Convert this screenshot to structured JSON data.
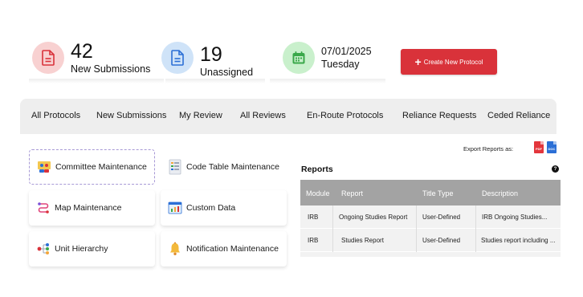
{
  "stats": [
    {
      "value": "42",
      "label": "New Submissions",
      "icon": "document-icon",
      "color": "#f8d1d1"
    },
    {
      "value": "19",
      "label": "Unassigned",
      "icon": "document-icon",
      "color": "#cfe3f8"
    },
    {
      "date": "07/01/2025",
      "day": "Tuesday",
      "icon": "calendar-icon",
      "color": "#c9f0cc"
    }
  ],
  "create_button": {
    "label": "Create New Protocol",
    "color": "#d9323a"
  },
  "tabs": [
    "All Protocols",
    "New Submissions",
    "My Review",
    "All Reviews",
    "En-Route Protocols",
    "Reliance Requests",
    "Ceded Reliance"
  ],
  "tiles": [
    {
      "label": "Committee Maintenance",
      "icon": "committee-icon"
    },
    {
      "label": "Code Table Maintenance",
      "icon": "code-table-icon"
    },
    {
      "label": "Map Maintenance",
      "icon": "map-route-icon"
    },
    {
      "label": "Custom Data",
      "icon": "custom-data-icon"
    },
    {
      "label": "Unit Hierarchy",
      "icon": "hierarchy-icon"
    },
    {
      "label": "Notification Maintenance",
      "icon": "bell-icon"
    }
  ],
  "reports": {
    "export_label": "Export Reports as:",
    "pdf_label": "PDF",
    "doc_label": "DOC",
    "title": "Reports",
    "help": "?",
    "columns": [
      "Module",
      "Report",
      "Title Type",
      "Description"
    ],
    "rows": [
      [
        "IRB",
        "Ongoing Studies Report",
        "User-Defined",
        "IRB Ongoing Studies..."
      ],
      [
        "IRB",
        "Studies Report",
        "User-Defined",
        "Studies report including ..."
      ]
    ]
  }
}
